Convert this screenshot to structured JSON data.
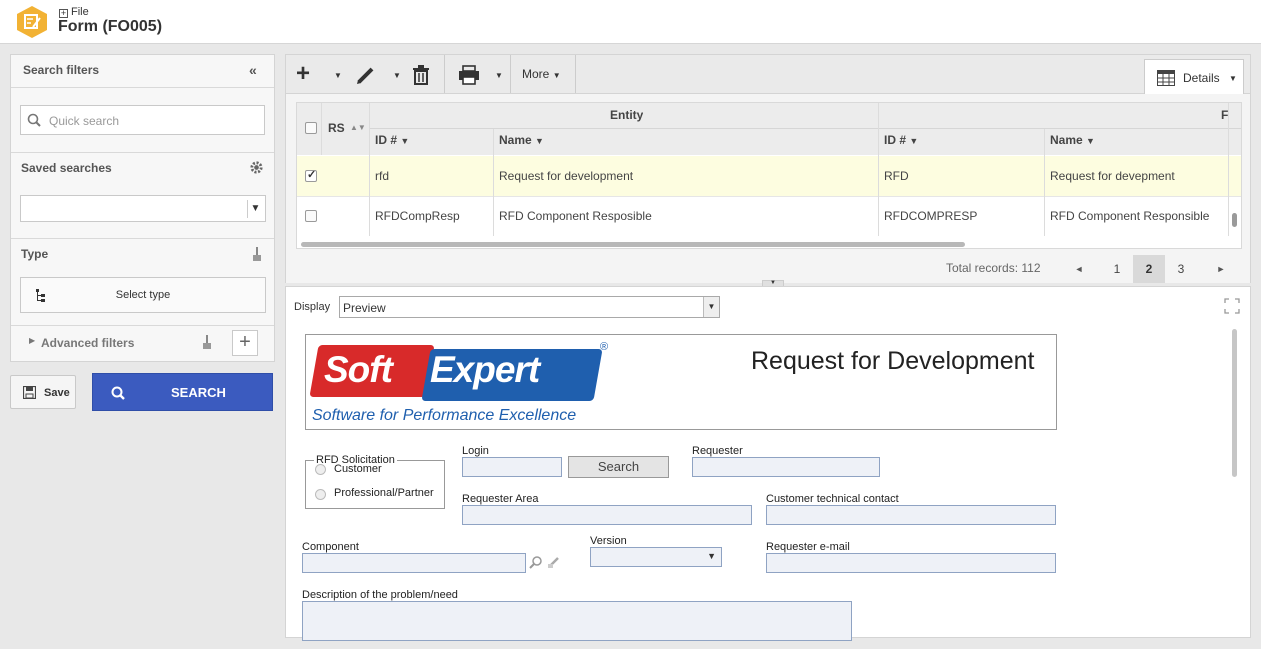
{
  "header": {
    "breadcrumb": "File",
    "title": "Form (FO005)"
  },
  "filters": {
    "title": "Search filters",
    "quick_search_placeholder": "Quick search",
    "saved_searches_label": "Saved searches",
    "type_label": "Type",
    "select_type_label": "Select type",
    "advanced_filters_label": "Advanced filters",
    "save_label": "Save",
    "search_label": "SEARCH"
  },
  "toolbar": {
    "more_label": "More",
    "details_label": "Details"
  },
  "table": {
    "group_entity": "Entity",
    "group_form": "F",
    "col_rs": "RS",
    "col_id": "ID #",
    "col_name": "Name",
    "col_id2": "ID #",
    "col_name2": "Name",
    "rows": [
      {
        "checked": true,
        "id": "rfd",
        "name": "Request for development",
        "id2": "RFD",
        "name2": "Request for devepment"
      },
      {
        "checked": false,
        "id": "RFDCompResp",
        "name": "RFD Component Resposible",
        "id2": "RFDCOMPRESP",
        "name2": "RFD Component Responsible"
      }
    ]
  },
  "pagination": {
    "total": "Total records: 112",
    "prev": "◄",
    "next": "►",
    "pages": [
      "1",
      "2",
      "3"
    ],
    "current": "2"
  },
  "preview": {
    "display_label": "Display",
    "display_value": "Preview",
    "logo_word1": "Soft",
    "logo_word2": "Expert",
    "logo_tagline": "Software for Performance Excellence",
    "logo_reg": "®",
    "form_title": "Request for Development",
    "rfd_solicitation_label": "RFD Solicitation",
    "option_customer": "Customer",
    "option_partner": "Professional/Partner",
    "login_label": "Login",
    "search_button": "Search",
    "requester_label": "Requester",
    "requester_area_label": "Requester Area",
    "customer_contact_label": "Customer technical contact",
    "component_label": "Component",
    "version_label": "Version",
    "requester_email_label": "Requester e-mail",
    "description_label": "Description of the problem/need"
  },
  "colors": {
    "accent": "#3b5bbf",
    "selected_row": "#fdfde0",
    "logo_red": "#d82a2a",
    "logo_blue": "#1f5fae",
    "app_icon": "#f2b234"
  }
}
